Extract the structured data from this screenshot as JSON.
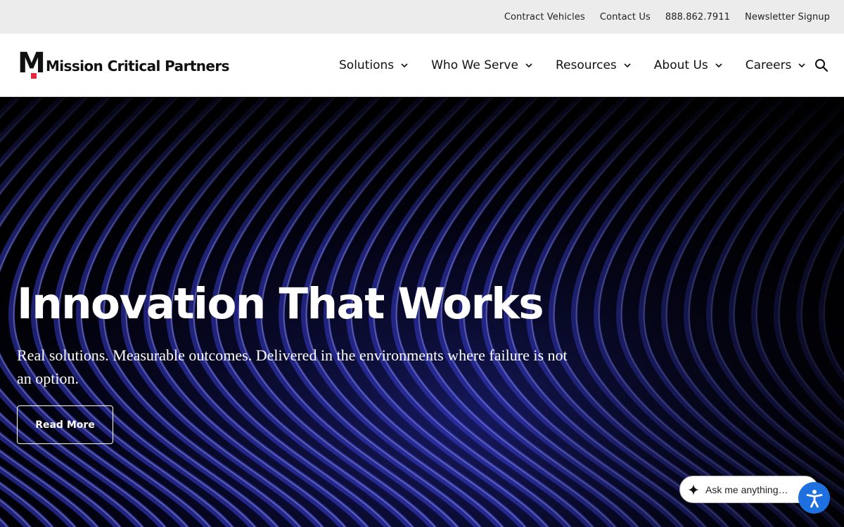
{
  "utility_nav": {
    "links": [
      "Contract Vehicles",
      "Contact Us",
      "888.862.7911",
      "Newsletter Signup"
    ]
  },
  "header": {
    "logo_text": "Mission Critical Partners",
    "logo_letter": "M",
    "nav": [
      {
        "label": "Solutions"
      },
      {
        "label": "Who We Serve"
      },
      {
        "label": "Resources"
      },
      {
        "label": "About Us"
      },
      {
        "label": "Careers"
      }
    ],
    "search_icon": "search-icon"
  },
  "hero": {
    "title": "Innovation That Works",
    "subtitle": "Real solutions. Measurable outcomes. Delivered in the environments where failure is not an option.",
    "cta_label": "Read More"
  },
  "chat": {
    "placeholder": "Ask me anything…"
  },
  "accessibility": {
    "icon": "accessibility-icon"
  },
  "colors": {
    "accent_red": "#e2283a",
    "accessibility_blue": "#1e6fe0",
    "hero_blue": "#3a3fd8"
  }
}
